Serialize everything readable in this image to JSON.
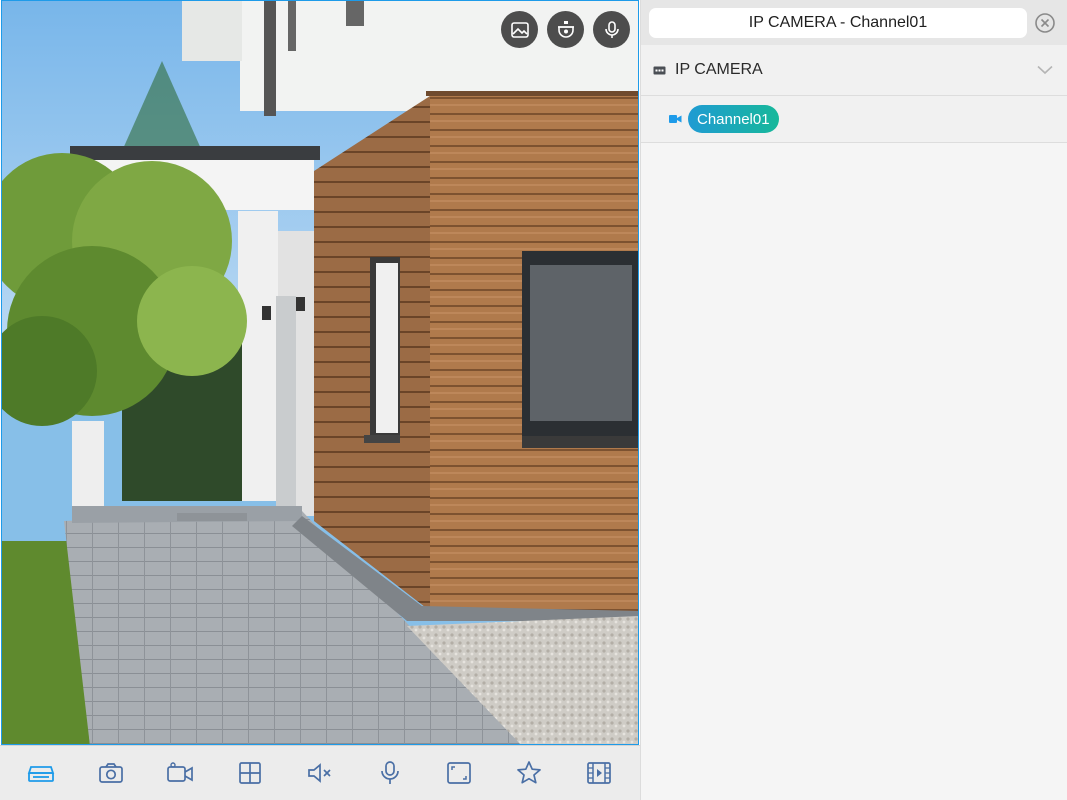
{
  "panel": {
    "title": "IP CAMERA - Channel01",
    "device": {
      "name": "IP CAMERA"
    },
    "channels": [
      {
        "label": "Channel01",
        "selected": true
      }
    ]
  },
  "overlay_controls": [
    "capture-icon",
    "ptz-icon",
    "talk-mic-icon"
  ],
  "toolbar": [
    "nvr-icon",
    "snapshot-icon",
    "record-icon",
    "grid-icon",
    "mute-icon",
    "mic-icon",
    "fullscreen-icon",
    "favorite-icon",
    "playback-icon"
  ],
  "colors": {
    "accent": "#1e9be9",
    "pill_start": "#1f9bd3",
    "pill_end": "#17b89a",
    "icon": "#4a6fa5"
  }
}
